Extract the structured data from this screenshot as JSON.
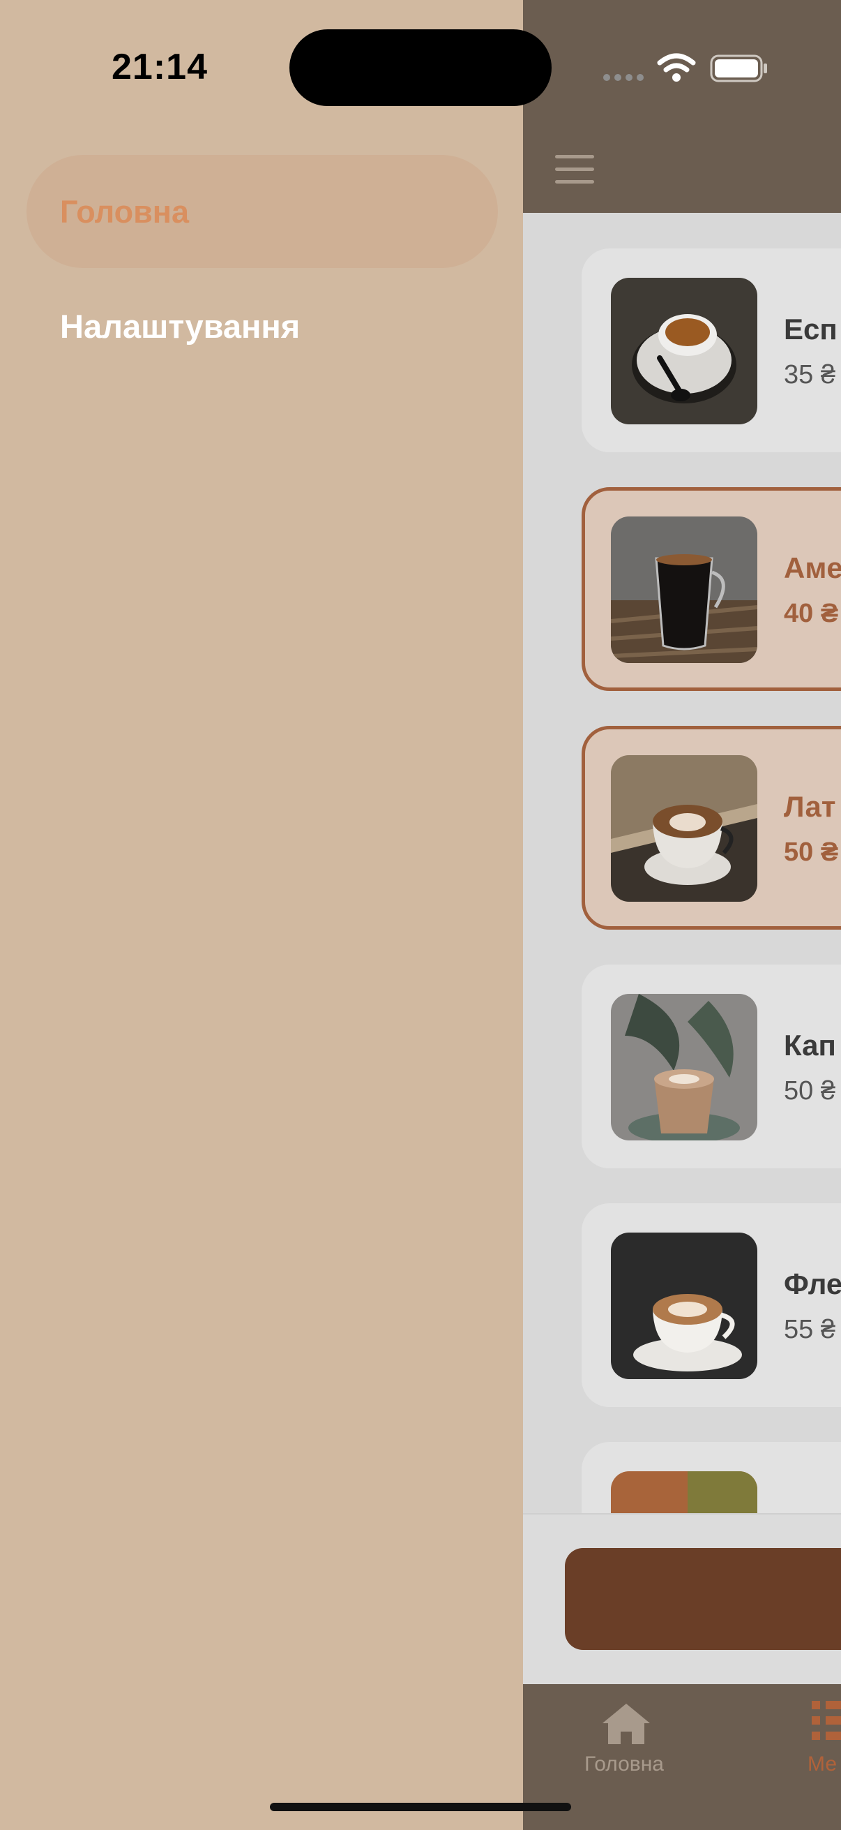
{
  "status_bar": {
    "time": "21:14"
  },
  "drawer": {
    "items": [
      {
        "label": "Головна",
        "active": true
      },
      {
        "label": "Налаштування",
        "active": false
      }
    ],
    "active_color": "#d98f5f"
  },
  "menu_list": {
    "items": [
      {
        "title": "Есп",
        "price": "35 ₴",
        "selected": false
      },
      {
        "title": "Аме",
        "price": "40 ₴",
        "selected": true
      },
      {
        "title": "Лат",
        "price": "50 ₴",
        "selected": true
      },
      {
        "title": "Кап",
        "price": "50 ₴",
        "selected": false
      },
      {
        "title": "Фле",
        "price": "55 ₴",
        "selected": false
      }
    ]
  },
  "tabbar": {
    "home_label": "Головна",
    "menu_label": "Ме"
  },
  "colors": {
    "accent": "#a1603d",
    "cart_button": "#6a3e27",
    "drawer_bg": "#d1b9a0",
    "header_bg": "#6b5d50"
  }
}
